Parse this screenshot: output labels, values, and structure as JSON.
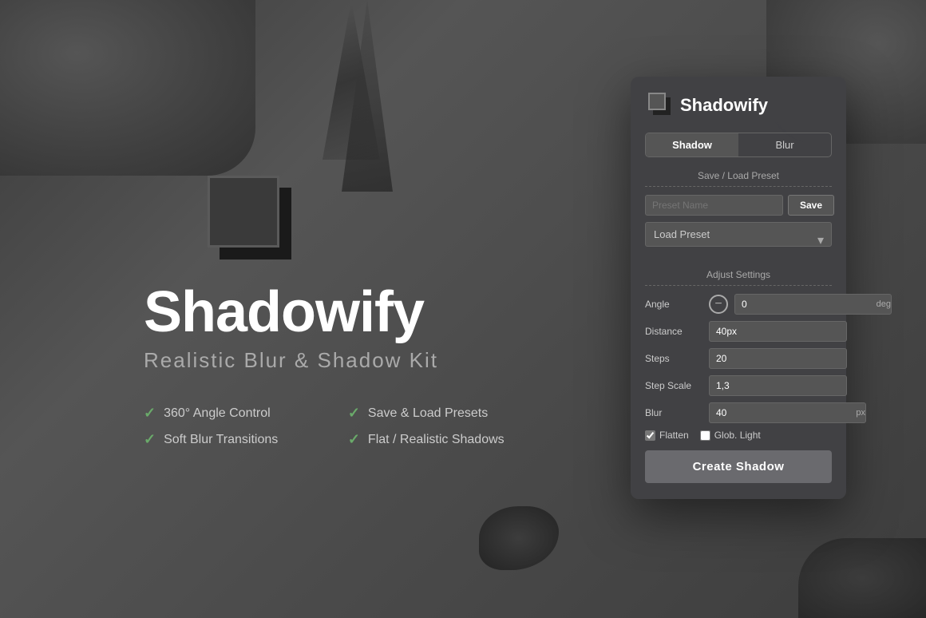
{
  "app": {
    "name": "Shadowify",
    "subtitle": "Realistic Blur & Shadow Kit",
    "logo_alt": "Shadowify logo icon"
  },
  "features": [
    {
      "id": "f1",
      "text": "360° Angle Control"
    },
    {
      "id": "f2",
      "text": "Save & Load Presets"
    },
    {
      "id": "f3",
      "text": "Soft Blur Transitions"
    },
    {
      "id": "f4",
      "text": "Flat / Realistic Shadows"
    }
  ],
  "panel": {
    "title": "Shadowify",
    "tabs": [
      {
        "id": "shadow",
        "label": "Shadow",
        "active": true
      },
      {
        "id": "blur",
        "label": "Blur",
        "active": false
      }
    ],
    "save_load": {
      "section_label": "Save / Load Preset",
      "preset_name_placeholder": "Preset Name",
      "save_label": "Save",
      "load_preset_label": "Load Preset",
      "load_options": [
        "Load Preset"
      ]
    },
    "adjust": {
      "section_label": "Adjust Settings",
      "fields": [
        {
          "id": "angle",
          "label": "Angle",
          "value": "0",
          "unit": "deg"
        },
        {
          "id": "distance",
          "label": "Distance",
          "value": "40px",
          "unit": ""
        },
        {
          "id": "steps",
          "label": "Steps",
          "value": "20",
          "unit": ""
        },
        {
          "id": "step_scale",
          "label": "Step Scale",
          "value": "1,3",
          "unit": ""
        },
        {
          "id": "blur",
          "label": "Blur",
          "value": "40",
          "unit": "px"
        }
      ],
      "flatten_label": "Flatten",
      "flatten_checked": true,
      "glob_light_label": "Glob. Light",
      "glob_light_checked": false
    },
    "create_shadow_label": "Create Shadow"
  }
}
